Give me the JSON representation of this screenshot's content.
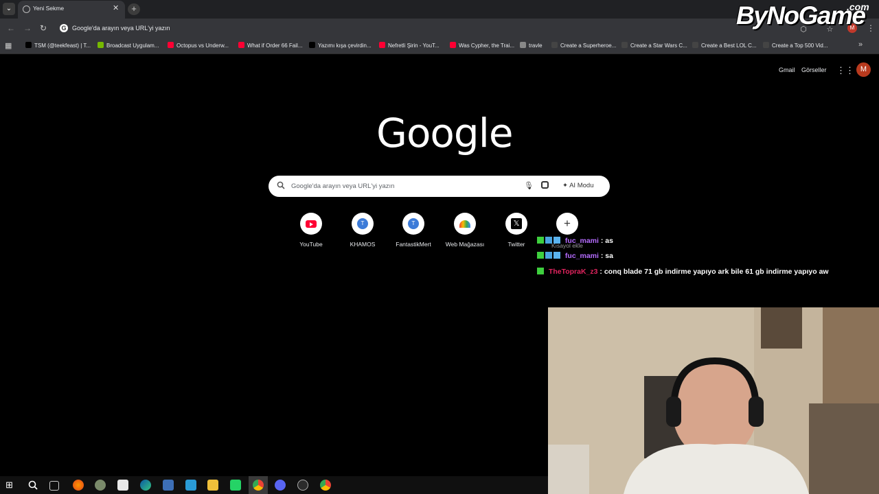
{
  "browser": {
    "tab": {
      "title": "Yeni Sekme",
      "close": "✕"
    },
    "new_tab": "+",
    "tab_menu": "⌄",
    "omnibox": {
      "text": "Google'da arayın veya URL'yi yazın"
    },
    "profile_initial": "M",
    "nav": {
      "back": "←",
      "forward": "→",
      "reload": "↻"
    }
  },
  "bookmarks": [
    {
      "label": "TSM (@teekfeast) | T...",
      "icon_color": "#000000"
    },
    {
      "label": "Broadcast Uygulam...",
      "icon_color": "#76b900"
    },
    {
      "label": "Octopus vs Underw...",
      "icon_color": "#ff0033"
    },
    {
      "label": "What if Order 66 Fail...",
      "icon_color": "#ff0033"
    },
    {
      "label": "Yazımı kışa çevirdin...",
      "icon_color": "#000000"
    },
    {
      "label": "Nefretli Şirin - YouT...",
      "icon_color": "#ff0033"
    },
    {
      "label": "Was Cypher, the Trai...",
      "icon_color": "#ff0033"
    },
    {
      "label": "travle",
      "icon_color": "#888888"
    },
    {
      "label": "Create a Superheroe...",
      "icon_color": "#444444"
    },
    {
      "label": "Create a Star Wars C...",
      "icon_color": "#444444"
    },
    {
      "label": "Create a Best LOL C...",
      "icon_color": "#444444"
    },
    {
      "label": "Create a Top 500 Vid...",
      "icon_color": "#444444"
    }
  ],
  "watermark": {
    "brand": "ByNoGame",
    "tld": ".com"
  },
  "ntp": {
    "top_links": {
      "gmail": "Gmail",
      "images": "Görseller"
    },
    "avatar_initial": "M",
    "logo": "Google",
    "search": {
      "placeholder": "Google'da arayın veya URL'yi yazın",
      "ai_mode": "AI Modu"
    },
    "shortcuts": [
      {
        "label": "YouTube",
        "icon": "youtube-icon"
      },
      {
        "label": "KHAMOS",
        "icon": "T",
        "initial": "T"
      },
      {
        "label": "FantastikMert",
        "icon": "T",
        "initial": "T"
      },
      {
        "label": "Web Mağazası",
        "icon": "chrome-web-store-icon"
      },
      {
        "label": "Twitter",
        "icon": "x-icon",
        "initial": "𝕏"
      }
    ],
    "add_shortcut": {
      "glyph": "+",
      "label": "Kısayol ekle"
    }
  },
  "chat": [
    {
      "user": "fuc_mami",
      "message": ": as",
      "color": "#b56cff"
    },
    {
      "user": "fuc_mami",
      "message": ": sa",
      "color": "#b56cff"
    },
    {
      "user": "TheTopraK_z3",
      "message": ": conq blade 71 gb indirme yapıyo ark bile 61 gb indirme yapıyo aw",
      "color": "#e0245e"
    }
  ]
}
